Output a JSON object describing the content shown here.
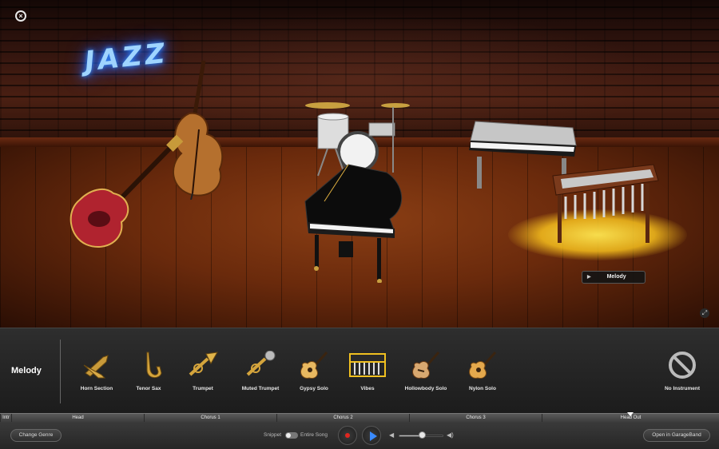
{
  "window": {
    "close_glyph": "×"
  },
  "stage": {
    "neon_sign": "JAZZ",
    "selected_tag": {
      "play_glyph": "▶",
      "label": "Melody"
    },
    "fullscreen_glyph": "⤢"
  },
  "colors": {
    "neon": "#9fd4ff",
    "spotlight": "#ffd000",
    "record": "#e0261f",
    "play": "#3a8bff"
  },
  "strip": {
    "title": "Melody",
    "items": [
      {
        "label": "Horn Section",
        "icon": "horn-section-icon"
      },
      {
        "label": "Tenor Sax",
        "icon": "tenor-sax-icon"
      },
      {
        "label": "Trumpet",
        "icon": "trumpet-icon"
      },
      {
        "label": "Muted Trumpet",
        "icon": "muted-trumpet-icon"
      },
      {
        "label": "Gypsy Solo",
        "icon": "acoustic-guitar-icon"
      },
      {
        "label": "Vibes",
        "icon": "vibraphone-icon"
      },
      {
        "label": "Hollowbody Solo",
        "icon": "hollowbody-guitar-icon"
      },
      {
        "label": "Nylon Solo",
        "icon": "nylon-guitar-icon"
      },
      {
        "label": "No Instrument",
        "icon": "no-instrument-icon"
      }
    ]
  },
  "timeline": {
    "sections": [
      "Intr",
      "Head",
      "Chorus 1",
      "Chorus 2",
      "Chorus 3",
      "Head Out"
    ]
  },
  "bottom_bar": {
    "change_genre": "Change Genre",
    "snippet": "Snippet",
    "entire_song": "Entire Song",
    "open_in_garageband": "Open in GarageBand",
    "volume_level": 0.5
  }
}
